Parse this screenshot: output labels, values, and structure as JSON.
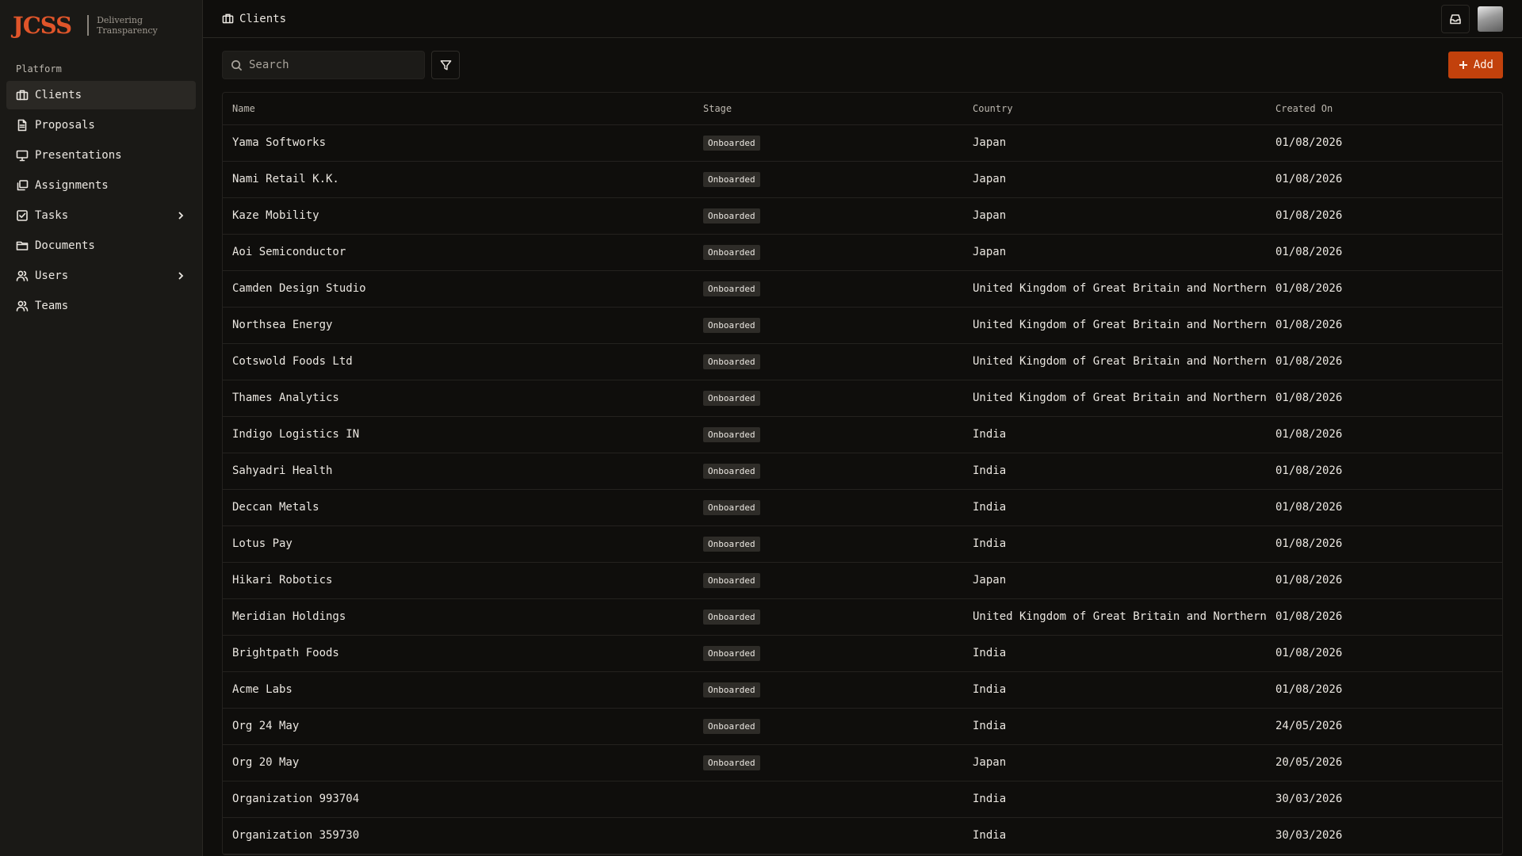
{
  "brand": {
    "logo": "JCSS",
    "tagline_line1": "Delivering",
    "tagline_line2": "Transparency"
  },
  "sidebar": {
    "section": "Platform",
    "items": [
      {
        "label": "Clients",
        "icon": "building-icon",
        "active": true
      },
      {
        "label": "Proposals",
        "icon": "document-icon"
      },
      {
        "label": "Presentations",
        "icon": "presentation-icon"
      },
      {
        "label": "Assignments",
        "icon": "layers-icon"
      },
      {
        "label": "Tasks",
        "icon": "checkbox-icon",
        "expandable": true
      },
      {
        "label": "Documents",
        "icon": "folder-icon"
      },
      {
        "label": "Users",
        "icon": "users-icon",
        "expandable": true
      },
      {
        "label": "Teams",
        "icon": "team-icon"
      }
    ]
  },
  "header": {
    "breadcrumb": "Clients"
  },
  "toolbar": {
    "search_placeholder": "Search",
    "add_label": "Add"
  },
  "colors": {
    "accent": "#c2410c",
    "brand": "#e0552a",
    "background": "#0f0e0c",
    "sidebar": "#1a1916"
  },
  "table": {
    "columns": [
      "Name",
      "Stage",
      "Country",
      "Created On"
    ],
    "rows": [
      {
        "name": "Yama Softworks",
        "stage": "Onboarded",
        "country": "Japan",
        "created": "01/08/2026"
      },
      {
        "name": "Nami Retail K.K.",
        "stage": "Onboarded",
        "country": "Japan",
        "created": "01/08/2026"
      },
      {
        "name": "Kaze Mobility",
        "stage": "Onboarded",
        "country": "Japan",
        "created": "01/08/2026"
      },
      {
        "name": "Aoi Semiconductor",
        "stage": "Onboarded",
        "country": "Japan",
        "created": "01/08/2026"
      },
      {
        "name": "Camden Design Studio",
        "stage": "Onboarded",
        "country": "United Kingdom of Great Britain and Northern",
        "created": "01/08/2026"
      },
      {
        "name": "Northsea Energy",
        "stage": "Onboarded",
        "country": "United Kingdom of Great Britain and Northern",
        "created": "01/08/2026"
      },
      {
        "name": "Cotswold Foods Ltd",
        "stage": "Onboarded",
        "country": "United Kingdom of Great Britain and Northern",
        "created": "01/08/2026"
      },
      {
        "name": "Thames Analytics",
        "stage": "Onboarded",
        "country": "United Kingdom of Great Britain and Northern",
        "created": "01/08/2026"
      },
      {
        "name": "Indigo Logistics IN",
        "stage": "Onboarded",
        "country": "India",
        "created": "01/08/2026"
      },
      {
        "name": "Sahyadri Health",
        "stage": "Onboarded",
        "country": "India",
        "created": "01/08/2026"
      },
      {
        "name": "Deccan Metals",
        "stage": "Onboarded",
        "country": "India",
        "created": "01/08/2026"
      },
      {
        "name": "Lotus Pay",
        "stage": "Onboarded",
        "country": "India",
        "created": "01/08/2026"
      },
      {
        "name": "Hikari Robotics",
        "stage": "Onboarded",
        "country": "Japan",
        "created": "01/08/2026"
      },
      {
        "name": "Meridian Holdings",
        "stage": "Onboarded",
        "country": "United Kingdom of Great Britain and Northern",
        "created": "01/08/2026"
      },
      {
        "name": "Brightpath Foods",
        "stage": "Onboarded",
        "country": "India",
        "created": "01/08/2026"
      },
      {
        "name": "Acme Labs",
        "stage": "Onboarded",
        "country": "India",
        "created": "01/08/2026"
      },
      {
        "name": "Org 24 May",
        "stage": "Onboarded",
        "country": "India",
        "created": "24/05/2026"
      },
      {
        "name": "Org 20 May",
        "stage": "Onboarded",
        "country": "Japan",
        "created": "20/05/2026"
      },
      {
        "name": "Organization 993704",
        "stage": "",
        "country": "India",
        "created": "30/03/2026"
      },
      {
        "name": "Organization 359730",
        "stage": "",
        "country": "India",
        "created": "30/03/2026"
      }
    ]
  }
}
